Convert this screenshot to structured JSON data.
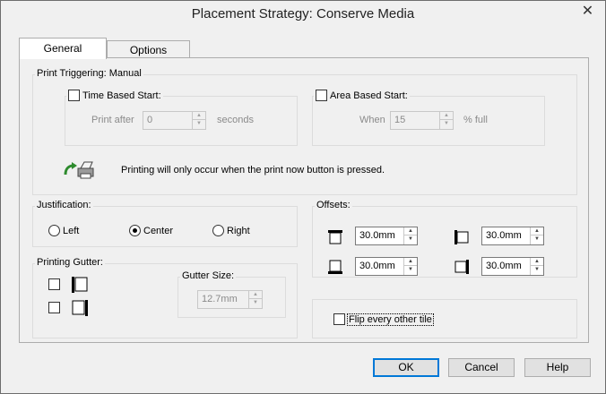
{
  "window": {
    "title": "Placement Strategy: Conserve Media",
    "close_glyph": "✕"
  },
  "tabs": [
    {
      "label": "General",
      "active": true
    },
    {
      "label": "Options",
      "active": false
    }
  ],
  "print_triggering": {
    "label": "Print Triggering: Manual",
    "time_based": {
      "label": "Time Based Start:",
      "checked": false,
      "prefix": "Print after",
      "value": "0",
      "suffix": "seconds"
    },
    "area_based": {
      "label": "Area Based Start:",
      "checked": false,
      "prefix": "When",
      "value": "15",
      "suffix": "% full"
    },
    "message": "Printing will only occur when the print now button is pressed.",
    "icon": "printer-with-green-arrow-icon"
  },
  "justification": {
    "label": "Justification:",
    "options": [
      {
        "label": "Left",
        "checked": false
      },
      {
        "label": "Center",
        "checked": true
      },
      {
        "label": "Right",
        "checked": false
      }
    ]
  },
  "offsets": {
    "label": "Offsets:",
    "top": "30.0mm",
    "left": "30.0mm",
    "bottom": "30.0mm",
    "right": "30.0mm"
  },
  "printing_gutter": {
    "label": "Printing Gutter:",
    "gutter_size_label": "Gutter Size:",
    "gutter_size_value": "12.7mm"
  },
  "flip": {
    "label": "Flip every other tile",
    "checked": false
  },
  "buttons": {
    "ok": "OK",
    "cancel": "Cancel",
    "help": "Help"
  },
  "colors": {
    "accent": "#0078d7",
    "dialog_bg": "#f0f0f0"
  }
}
